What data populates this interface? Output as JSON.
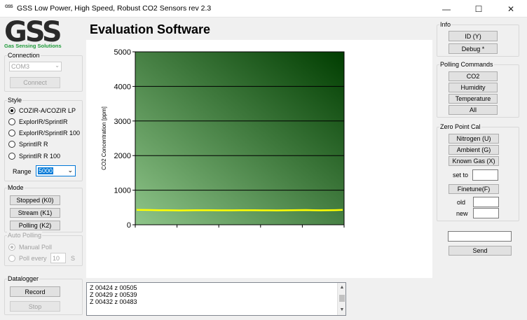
{
  "window": {
    "icon_text": "GSS",
    "title": "GSS Low Power, High Speed, Robust  CO2 Sensors  rev 2.3",
    "minimize_glyph": "—",
    "maximize_glyph": "☐",
    "close_glyph": "✕"
  },
  "logo": {
    "main": "GSS",
    "sub": "Gas Sensing Solutions",
    "sub_color": "#1f9a3a"
  },
  "heading": "Evaluation Software",
  "connection": {
    "legend": "Connection",
    "port_value": "COM3",
    "connect_label": "Connect"
  },
  "style": {
    "legend": "Style",
    "options": [
      "COZIR-A/COZIR LP",
      "ExplorIR/SprintIR",
      "ExplorIR/SprintIR 100",
      "SprintIR R",
      "SprintIR R 100"
    ],
    "selected": "COZIR-A/COZIR LP",
    "range_label": "Range",
    "range_value": "5000"
  },
  "mode": {
    "legend": "Mode",
    "stopped_label": "Stopped (K0)",
    "stream_label": "Stream (K1)",
    "polling_label": "Polling (K2)"
  },
  "auto_polling": {
    "legend": "Auto Polling",
    "manual_label": "Manual Poll",
    "every_label": "Poll every",
    "every_value": "10",
    "unit": "S"
  },
  "datalogger": {
    "legend": "Datalogger",
    "record_label": "Record",
    "stop_label": "Stop"
  },
  "log": {
    "lines": [
      "Z 00424 z 00505",
      "Z 00429 z 00539",
      "Z 00432 z 00483"
    ],
    "up_glyph": "▲",
    "down_glyph": "▼"
  },
  "info": {
    "legend": "Info",
    "id_label": "ID (Y)",
    "debug_label": "Debug *"
  },
  "polling_commands": {
    "legend": "Polling Commands",
    "co2_label": "CO2",
    "humidity_label": "Humidity",
    "temperature_label": "Temperature",
    "all_label": "All"
  },
  "zero_point": {
    "legend": "Zero Point Cal",
    "nitrogen_label": "Nitrogen (U)",
    "ambient_label": "Ambient (G)",
    "known_gas_label": "Known Gas (X)",
    "set_to_label": "set to",
    "set_to_value": "",
    "finetune_label": "Finetune(F)",
    "old_label": "old",
    "old_value": "",
    "new_label": "new",
    "new_value": ""
  },
  "send": {
    "input_value": "",
    "button_label": "Send"
  },
  "chart_data": {
    "type": "line",
    "ylabel": "CO2 Concentration [ppm]",
    "xlabel": "",
    "title": "",
    "ylim": [
      0,
      5000
    ],
    "yticks": [
      "0",
      "1000",
      "2000",
      "3000",
      "4000",
      "5000"
    ],
    "x_divisions": 5,
    "grid": "horizontal",
    "background_gradient": [
      "#8fc58a",
      "#003d00"
    ],
    "series": [
      {
        "color": "#ffff00",
        "values": [
          430,
          428,
          425,
          422,
          420,
          418,
          415,
          418,
          420,
          422,
          420,
          418,
          416,
          418,
          420,
          422,
          421,
          418,
          416,
          415,
          417,
          420,
          423,
          425,
          422,
          418,
          420,
          424,
          430
        ]
      }
    ]
  }
}
